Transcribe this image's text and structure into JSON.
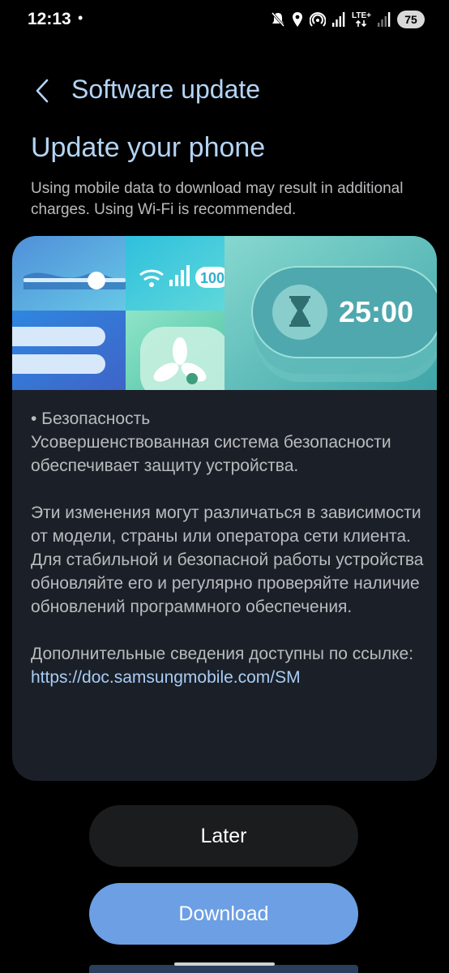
{
  "status_bar": {
    "time": "12:13",
    "dot": "•",
    "network_label": "LTE+",
    "battery": "75",
    "icons": [
      "mute-icon",
      "location-icon",
      "hotspot-icon",
      "signal-icon",
      "lte-icon",
      "signal-icon",
      "battery-icon"
    ]
  },
  "header": {
    "back_icon": "chevron-left-icon",
    "title": "Software update"
  },
  "update": {
    "heading": "Update your phone",
    "note": "Using mobile data to download may result in additional charges. Using Wi-Fi is recommended."
  },
  "banner": {
    "battery_text": "100",
    "timer_text": "25:00",
    "icons": [
      "wifi-icon",
      "signal-icon",
      "hourglass-icon",
      "fan-icon"
    ]
  },
  "release_notes": {
    "security_title": "• Безопасность",
    "security_body": "Усовершенствованная система безопасности обеспечивает защиту устройства.",
    "variation": "Эти изменения могут различаться в зависимости от модели, страны или оператора сети клиента.",
    "advice": "Для стабильной и безопасной работы устройства обновляйте его и регулярно проверяйте наличие обновлений программного обеспечения.",
    "more_info": "Дополнительные сведения доступны по ссылке:",
    "link": "https://doc.samsungmobile.com/SM"
  },
  "buttons": {
    "later": "Later",
    "download": "Download"
  },
  "colors": {
    "background": "#000000",
    "title": "#b4d4f5",
    "body_text": "#b9bbbe",
    "card": "#1b2028",
    "later_button": "#1b1c1e",
    "download_button": "#6c9fe3",
    "link": "#a9ccf5"
  }
}
